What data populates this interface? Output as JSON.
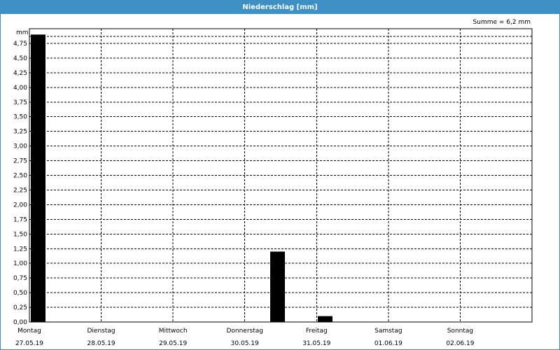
{
  "window": {
    "title": "Niederschlag [mm]"
  },
  "summary": "Summe = 6,2 mm",
  "colors": {
    "titlebar": "#3d8fc4",
    "bar": "#000000",
    "grid": "#000000"
  },
  "chart_data": {
    "type": "bar",
    "title": "Niederschlag [mm]",
    "ylabel": "mm",
    "ylim": [
      0,
      5.0
    ],
    "yticks": [
      "0,00",
      "0,25",
      "0,50",
      "0,75",
      "1,00",
      "1,25",
      "1,50",
      "1,75",
      "2,00",
      "2,25",
      "2,50",
      "2,75",
      "3,00",
      "3,25",
      "3,50",
      "3,75",
      "4,00",
      "4,25",
      "4,50",
      "4,75"
    ],
    "grid": true,
    "x_day_labels": [
      "Montag",
      "Dienstag",
      "Mittwoch",
      "Donnerstag",
      "Freitag",
      "Samstag",
      "Sonntag"
    ],
    "x_date_labels": [
      "27.05.19",
      "28.05.19",
      "29.05.19",
      "30.05.19",
      "31.05.19",
      "01.06.19",
      "02.06.19"
    ],
    "bars": [
      {
        "date": "27.05.19",
        "day": "Montag",
        "value": 4.9
      },
      {
        "date": "30.05.19",
        "day": "Donnerstag",
        "value": 1.2
      },
      {
        "date": "31.05.19",
        "day": "Freitag",
        "value": 0.1
      }
    ]
  }
}
